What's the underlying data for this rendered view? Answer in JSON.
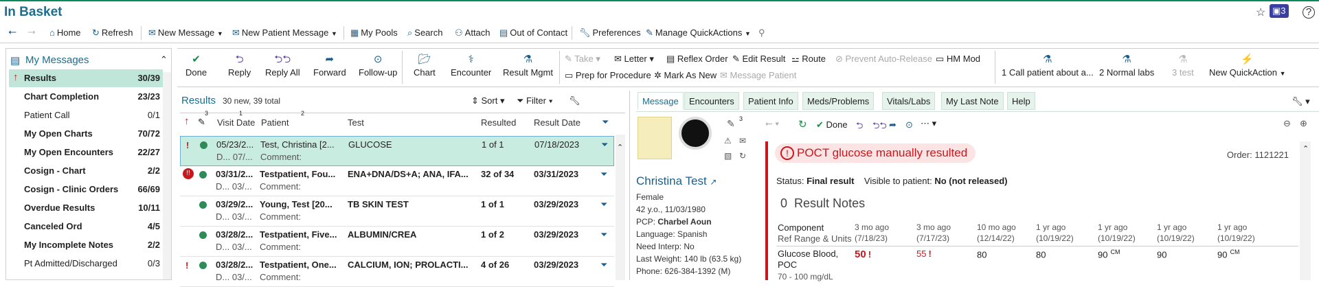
{
  "app": {
    "title": "In Basket",
    "top_right_icons": [
      "star-icon",
      "video-icon",
      "help-icon"
    ],
    "video_count": "3"
  },
  "toolbar": {
    "items": [
      {
        "icon": "home-icon",
        "label": "Home"
      },
      {
        "icon": "refresh-icon",
        "label": "Refresh"
      },
      {
        "icon": "new-message-icon",
        "label": "New Message"
      },
      {
        "icon": "new-patient-message-icon",
        "label": "New Patient Message"
      },
      {
        "icon": "my-pools-icon",
        "label": "My Pools"
      },
      {
        "icon": "search-icon",
        "label": "Search"
      },
      {
        "icon": "attach-icon",
        "label": "Attach"
      },
      {
        "icon": "out-of-contact-icon",
        "label": "Out of Contact"
      },
      {
        "icon": "wrench-icon",
        "label": "Preferences"
      },
      {
        "icon": "pencil-icon",
        "label": "Manage QuickActions"
      }
    ]
  },
  "sidebar": {
    "title": "My Messages",
    "items": [
      {
        "label": "Results",
        "count": "30/39",
        "bold": true,
        "selected": true,
        "flag": true
      },
      {
        "label": "Chart Completion",
        "count": "23/23",
        "bold": true
      },
      {
        "label": "Patient Call",
        "count": "0/1",
        "bold": false
      },
      {
        "label": "My Open Charts",
        "count": "70/72",
        "bold": true
      },
      {
        "label": "My Open Encounters",
        "count": "22/27",
        "bold": true
      },
      {
        "label": "Cosign - Chart",
        "count": "2/2",
        "bold": true
      },
      {
        "label": "Cosign - Clinic Orders",
        "count": "66/69",
        "bold": true
      },
      {
        "label": "Overdue Results",
        "count": "10/11",
        "bold": true
      },
      {
        "label": "Canceled Ord",
        "count": "4/5",
        "bold": true
      },
      {
        "label": "My Incomplete Notes",
        "count": "2/2",
        "bold": true
      },
      {
        "label": "Pt Admitted/Discharged",
        "count": "0/3",
        "bold": false
      }
    ]
  },
  "actions": {
    "buttons": [
      {
        "label": "Done",
        "icon": "check-icon"
      },
      {
        "label": "Reply",
        "icon": "reply-icon"
      },
      {
        "label": "Reply All",
        "icon": "reply-all-icon"
      },
      {
        "label": "Forward",
        "icon": "forward-icon"
      },
      {
        "label": "Follow-up",
        "icon": "follow-up-icon"
      },
      {
        "label": "Chart",
        "icon": "chart-icon"
      },
      {
        "label": "Encounter",
        "icon": "encounter-icon"
      },
      {
        "label": "Result Mgmt",
        "icon": "flask-icon"
      }
    ],
    "small": [
      {
        "label": "Take",
        "disabled": true
      },
      {
        "label": "Letter",
        "disabled": false
      },
      {
        "label": "Reflex Order",
        "disabled": false
      },
      {
        "label": "Edit Result",
        "disabled": false
      },
      {
        "label": "Route",
        "disabled": false
      },
      {
        "label": "Prevent Auto-Release",
        "disabled": true
      },
      {
        "label": "HM Mod",
        "disabled": false
      },
      {
        "label": "Prep for Procedure",
        "disabled": false
      },
      {
        "label": "Mark As New",
        "disabled": false
      },
      {
        "label": "Message Patient",
        "disabled": true
      }
    ],
    "quick": [
      {
        "label": "1 Call patient about a...",
        "disabled": false
      },
      {
        "label": "2 Normal labs",
        "disabled": false
      },
      {
        "label": "3 test",
        "disabled": true
      },
      {
        "label": "New QuickAction",
        "disabled": false
      }
    ]
  },
  "results": {
    "title": "Results",
    "subtitle": "30 new, 39 total",
    "sort_label": "Sort",
    "filter_label": "Filter",
    "columns": [
      "Visit Date",
      "Patient",
      "Test",
      "Resulted",
      "Result Date"
    ],
    "column_markers": {
      "flag": "3",
      "visit": "1",
      "patient": "2"
    },
    "rows": [
      {
        "flag": "!",
        "visit": "05/23/2...",
        "visit_sub": "D... 07/...",
        "patient": "Test, Christina [2...",
        "test": "GLUCOSE",
        "resulted": "1 of 1",
        "date": "07/18/2023",
        "comment": "Comment:",
        "selected": true,
        "bold": false
      },
      {
        "flag": "!!",
        "visit": "03/31/2...",
        "visit_sub": "D... 03/...",
        "patient": "Testpatient, Fou...",
        "test": "ENA+DNA/DS+A; ANA, IFA...",
        "resulted": "32 of 34",
        "date": "03/31/2023",
        "comment": "Comment:",
        "selected": false,
        "bold": true
      },
      {
        "flag": "",
        "visit": "03/29/2...",
        "visit_sub": "D... 03/...",
        "patient": "Young, Test [20...",
        "test": "TB SKIN TEST",
        "resulted": "1 of 1",
        "date": "03/29/2023",
        "comment": "Comment:",
        "selected": false,
        "bold": true
      },
      {
        "flag": "",
        "visit": "03/28/2...",
        "visit_sub": "D... 03/...",
        "patient": "Testpatient, Five...",
        "test": "ALBUMIN/CREA",
        "resulted": "1 of 2",
        "date": "03/29/2023",
        "comment": "Comment:",
        "selected": false,
        "bold": true
      },
      {
        "flag": "!",
        "visit": "03/28/2...",
        "visit_sub": "D... 03/...",
        "patient": "Testpatient, One...",
        "test": "CALCIUM, ION; PROLACTI...",
        "resulted": "4 of 26",
        "date": "03/29/2023",
        "comment": "Comment:",
        "selected": false,
        "bold": true
      }
    ]
  },
  "detail": {
    "tabs": [
      "Message",
      "Encounters",
      "Patient Info",
      "Meds/Problems",
      "Vitals/Labs",
      "My Last Note",
      "Help"
    ],
    "done_label": "Done",
    "notes_count": "3",
    "patient": {
      "name": "Christina Test",
      "sex": "Female",
      "age_dob": "42 y.o., 11/03/1980",
      "pcp_label": "PCP:",
      "pcp": "Charbel Aoun",
      "language": "Language: Spanish",
      "interp": "Need Interp: No",
      "weight": "Last Weight: 140 lb (63.5 kg)",
      "phone": "Phone: 626-384-1392 (M)"
    },
    "message": {
      "title": "POCT glucose manually resulted",
      "order": "Order: 1121221",
      "status_label": "Status:",
      "status": "Final result",
      "visible_label": "Visible to patient:",
      "visible": "No (not released)",
      "notes_count": "0",
      "notes_label": "Result Notes",
      "component_header": "Component",
      "range_header": "Ref Range & Units",
      "columns": [
        {
          "ago": "3 mo ago",
          "date": "(7/18/23)"
        },
        {
          "ago": "3 mo ago",
          "date": "(7/17/23)"
        },
        {
          "ago": "10 mo ago",
          "date": "(12/14/22)"
        },
        {
          "ago": "1 yr ago",
          "date": "(10/19/22)"
        },
        {
          "ago": "1 yr ago",
          "date": "(10/19/22)"
        },
        {
          "ago": "1 yr ago",
          "date": "(10/19/22)"
        },
        {
          "ago": "1 yr ago",
          "date": "(10/19/22)"
        }
      ],
      "component": "Glucose Blood,",
      "component2": "POC",
      "range": "70 - 100 mg/dL",
      "values": [
        "50",
        "55",
        "80",
        "80",
        "90",
        "90",
        "90"
      ],
      "value_flags": [
        "!",
        "!",
        "",
        "",
        "CM",
        "",
        "CM"
      ]
    }
  }
}
